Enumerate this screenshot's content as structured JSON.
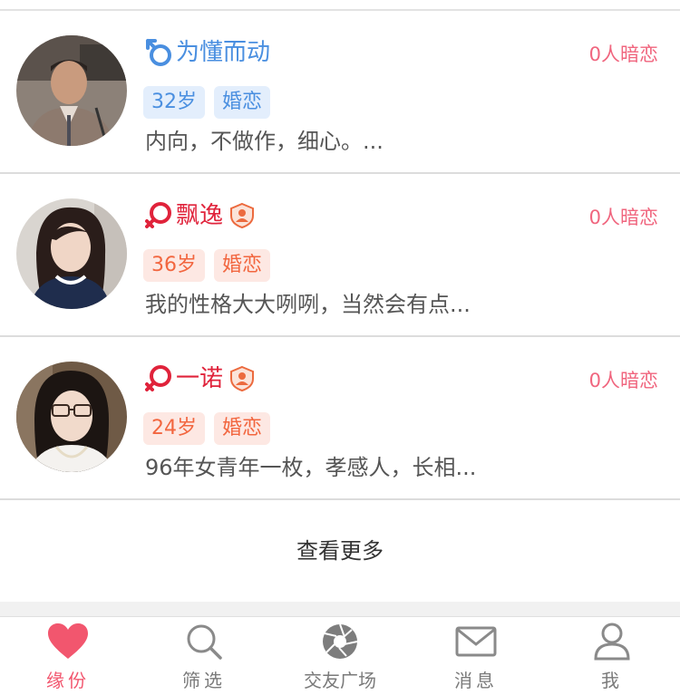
{
  "profiles": [
    {
      "name": "为懂而动",
      "gender": "male",
      "age_tag": "32岁",
      "type_tag": "婚恋",
      "intro": "内向，不做作，细心。...",
      "secret_admirers": "0人暗恋",
      "verified_badge": false
    },
    {
      "name": "飘逸",
      "gender": "female",
      "age_tag": "36岁",
      "type_tag": "婚恋",
      "intro": "我的性格大大咧咧，当然会有点...",
      "secret_admirers": "0人暗恋",
      "verified_badge": true
    },
    {
      "name": "一诺",
      "gender": "female",
      "age_tag": "24岁",
      "type_tag": "婚恋",
      "intro": "96年女青年一枚，孝感人，长相...",
      "secret_admirers": "0人暗恋",
      "verified_badge": true
    }
  ],
  "more_button": "查看更多",
  "tabbar": {
    "items": [
      {
        "label": "缘份",
        "icon": "heart-icon",
        "active": true
      },
      {
        "label": "筛选",
        "icon": "search-icon",
        "active": false
      },
      {
        "label": "交友广场",
        "icon": "shutter-icon",
        "active": false
      },
      {
        "label": "消息",
        "icon": "mail-icon",
        "active": false
      },
      {
        "label": "我",
        "icon": "user-icon",
        "active": false
      }
    ]
  },
  "colors": {
    "male": "#4a8fe0",
    "female": "#e0233b",
    "accent_pink": "#f2566e",
    "admirer_text": "#f0657e",
    "female_tag_text": "#f2663f"
  }
}
